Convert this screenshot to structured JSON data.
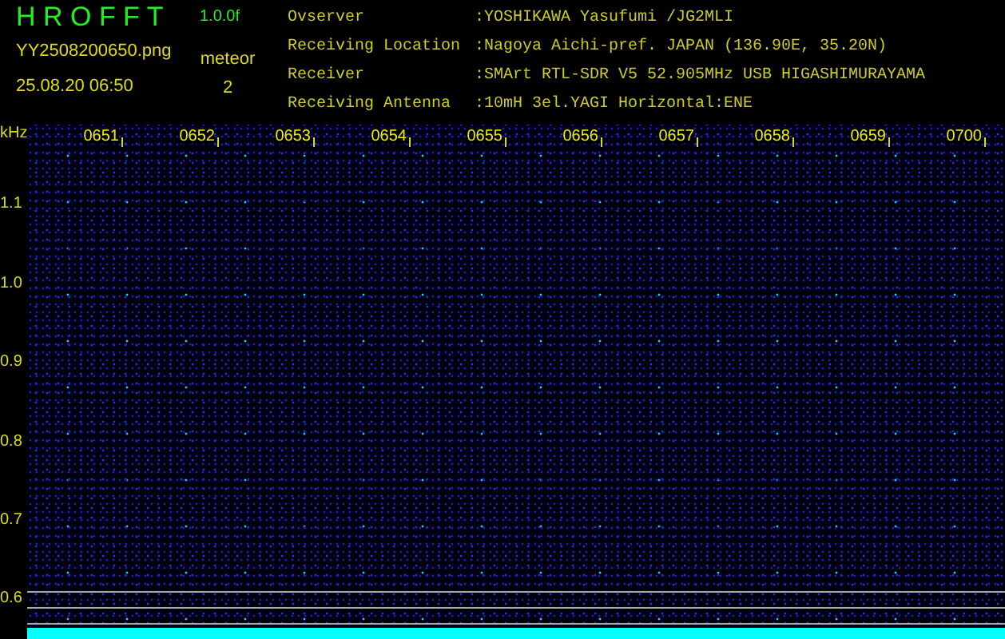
{
  "app": {
    "title": "H R O F F T",
    "version": "1.0.0f",
    "filename": "YY2508200650.png",
    "datetime": "25.08.20 06:50",
    "meteor_label": "meteor",
    "meteor_count": "2"
  },
  "info": [
    {
      "label": "Ovserver",
      "value": ":YOSHIKAWA Yasufumi /JG2MLI"
    },
    {
      "label": "Receiving Location",
      "value": ":Nagoya Aichi-pref. JAPAN (136.90E, 35.20N)"
    },
    {
      "label": "Receiver",
      "value": ":SMArt RTL-SDR V5 52.905MHz USB HIGASHIMURAYAMA"
    },
    {
      "label": "Receiving Antenna",
      "value": ":10mH 3el.YAGI Horizontal:ENE"
    }
  ],
  "spectrogram": {
    "y_unit": "kHz",
    "y_labels": [
      "1.1",
      "1.0",
      "0.9",
      "0.8",
      "0.7",
      "0.6"
    ],
    "time_labels": [
      "0651",
      "0652",
      "0653",
      "0654",
      "0655",
      "0656",
      "0657",
      "0658",
      "0659",
      "0700"
    ]
  }
}
